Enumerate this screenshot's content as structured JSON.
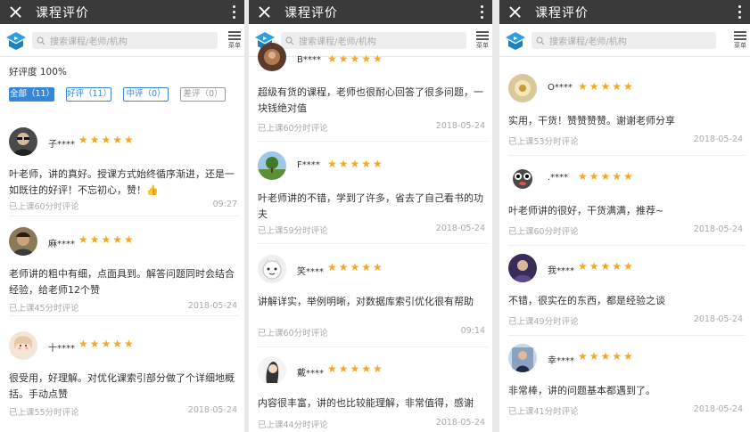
{
  "panels": [
    {
      "title": "课程评价",
      "search_placeholder": "搜索课程/老师/机构",
      "menu_label": "菜单",
      "rating_summary": "好评度 100%",
      "filters": [
        "全部（11）",
        "好评（11）",
        "中评（0）",
        "差评（0）"
      ],
      "reviews": [
        {
          "user": "子****",
          "stars": "★★★★★",
          "text": "叶老师，讲的真好。授课方式始终循序渐进，还是一如既往的好评！不忘初心，赞！👍",
          "meta": "已上课60分时评论",
          "date": "09:27"
        },
        {
          "user": "麻****",
          "stars": "★★★★★",
          "text": "老师讲的粗中有细，点面具到。解答问题同时会结合经验，给老师12个赞",
          "meta": "已上课45分时评论",
          "date": "2018-05-24"
        },
        {
          "user": "十****",
          "stars": "★★★★★",
          "text": "很受用，好理解。对优化课索引部分做了个详细地概括。手动点赞",
          "meta": "已上课55分时评论",
          "date": "2018-05-24"
        }
      ]
    },
    {
      "title": "课程评价",
      "search_placeholder": "搜索课程/老师/机构",
      "menu_label": "菜单",
      "reviews": [
        {
          "user": "B****",
          "stars": "★★★★★",
          "text": "超级有货的课程，老师也很耐心回答了很多问题，一块钱绝对值",
          "meta": "已上课60分时评论",
          "date": "2018-05-24"
        },
        {
          "user": "F****",
          "stars": "★★★★★",
          "text": "叶老师讲的不错，学到了许多，省去了自己看书的功夫",
          "meta": "已上课59分时评论",
          "date": "2018-05-24"
        },
        {
          "user": "笑****",
          "stars": "★★★★★",
          "text": "讲解详实，举例明晰，对数据库索引优化很有帮助",
          "meta": "已上课60分时评论",
          "date": "09:14"
        },
        {
          "user": "戴****",
          "stars": "★★★★★",
          "text": "内容很丰富，讲的也比较能理解，非常值得，感谢",
          "meta": "已上课44分时评论",
          "date": "2018-05-24"
        }
      ]
    },
    {
      "title": "课程评价",
      "search_placeholder": "搜索课程/老师/机构",
      "menu_label": "菜单",
      "reviews": [
        {
          "user": "O****",
          "stars": "★★★★★",
          "text": "实用，干货！赞赞赞赞。谢谢老师分享",
          "meta": "已上课53分时评论",
          "date": "2018-05-24"
        },
        {
          "user": ".****",
          "stars": "★★★★★",
          "text": "叶老师讲的很好，干货满满，推荐~",
          "meta": "已上课60分时评论",
          "date": "2018-05-24"
        },
        {
          "user": "我****",
          "stars": "★★★★★",
          "text": "不错，很实在的东西，都是经验之谈",
          "meta": "已上课49分时评论",
          "date": "2018-05-24"
        },
        {
          "user": "幸****",
          "stars": "★★★★★",
          "text": "非常棒，讲的问题基本都遇到了。",
          "meta": "已上课41分时评论",
          "date": "2018-05-24"
        }
      ]
    }
  ],
  "colors": {
    "titlebar": "#3a3a3a",
    "accent": "#3a86d6",
    "star": "#f5a623",
    "logo": "#2d9fe0"
  },
  "icons": [
    "close-icon",
    "more-icon",
    "logo-icon",
    "search-icon",
    "menu-icon"
  ]
}
